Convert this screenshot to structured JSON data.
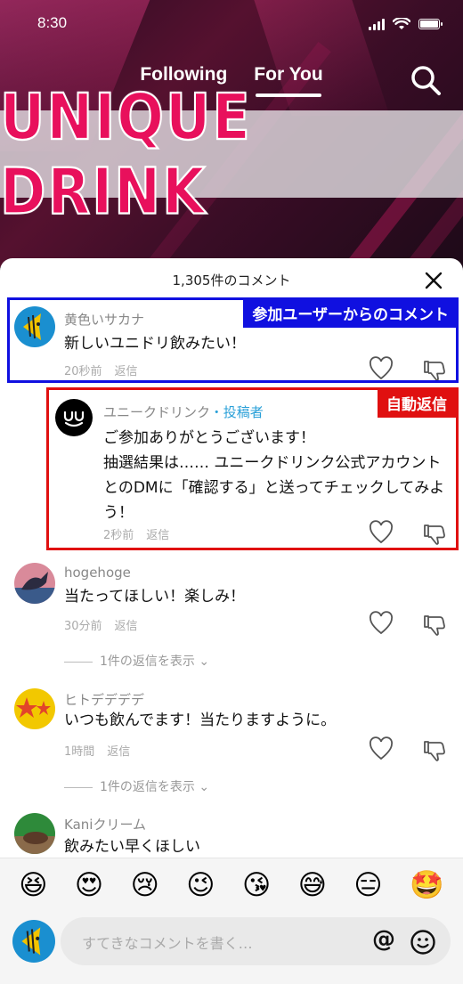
{
  "status_bar": {
    "time": "8:30"
  },
  "feed_tabs": {
    "following": "Following",
    "for_you": "For You"
  },
  "video": {
    "title": "UNIQUE DRINK"
  },
  "sheet": {
    "title": "1,305件のコメント"
  },
  "annotations": {
    "user_comment": "参加ユーザーからのコメント",
    "auto_reply": "自動返信"
  },
  "comments": [
    {
      "name": "黄色いサカナ",
      "text": "新しいユニドリ飲みたい！",
      "time": "20秒前",
      "reply": "返信"
    },
    {
      "name": "ユニークドリンク",
      "tag": "・投稿者",
      "text": "ご参加ありがとうございます！\n抽選結果は…… ユニークドリンク公式アカウントとのDMに「確認する」と送ってチェックしてみよう！",
      "time": "2秒前",
      "reply": "返信"
    },
    {
      "name": "hogehoge",
      "text": "当たってほしい！楽しみ！",
      "time": "30分前",
      "reply": "返信",
      "more": "1件の返信を表示 ⌄"
    },
    {
      "name": "ヒトデデデデ",
      "text": "いつも飲んでます！当たりますように。",
      "time": "1時間",
      "reply": "返信",
      "more": "1件の返信を表示 ⌄"
    },
    {
      "name": "Kaniクリーム",
      "text": "飲みたい早くほしい"
    }
  ],
  "emoji_bar": [
    "😆",
    "😍",
    "😢",
    "😉",
    "😘",
    "😅",
    "😑",
    "🤩"
  ],
  "input": {
    "placeholder": "すてきなコメントを書く…",
    "at": "@"
  },
  "colors": {
    "brand_pink": "#e8105c",
    "annotation_blue": "#1010e0",
    "annotation_red": "#e01010",
    "poster_tag": "#2aa0d8"
  }
}
